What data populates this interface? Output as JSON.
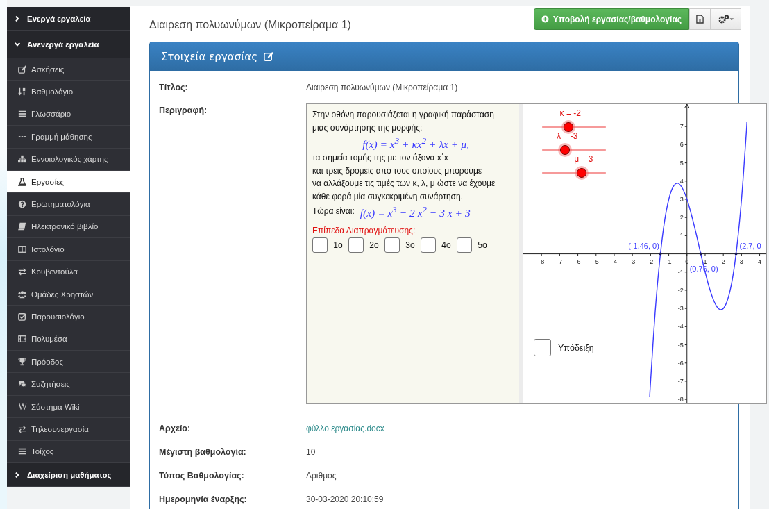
{
  "sidebar": {
    "sections": [
      {
        "label": "Ενεργά εργαλεία",
        "expanded": false
      },
      {
        "label": "Ανενεργά εργαλεία",
        "expanded": true,
        "items": [
          {
            "label": "Ασκήσεις",
            "selected": false
          },
          {
            "label": "Βαθμολόγιο",
            "selected": false
          },
          {
            "label": "Γλωσσάριο",
            "selected": false
          },
          {
            "label": "Γραμμή μάθησης",
            "selected": false
          },
          {
            "label": "Εννοιολογικός χάρτης",
            "selected": false
          },
          {
            "label": "Εργασίες",
            "selected": true
          },
          {
            "label": "Ερωτηματολόγια",
            "selected": false
          },
          {
            "label": "Ηλεκτρονικό βιβλίο",
            "selected": false
          },
          {
            "label": "Ιστολόγιο",
            "selected": false
          },
          {
            "label": "Κουβεντούλα",
            "selected": false
          },
          {
            "label": "Ομάδες Χρηστών",
            "selected": false
          },
          {
            "label": "Παρουσιολόγιο",
            "selected": false
          },
          {
            "label": "Πολυμέσα",
            "selected": false
          },
          {
            "label": "Πρόοδος",
            "selected": false
          },
          {
            "label": "Συζητήσεις",
            "selected": false
          },
          {
            "label": "Σύστημα Wiki",
            "selected": false,
            "icon": "W"
          },
          {
            "label": "Τηλεσυνεργασία",
            "selected": false
          },
          {
            "label": "Τοίχος",
            "selected": false
          }
        ]
      },
      {
        "label": "Διαχείριση μαθήματος",
        "expanded": false
      }
    ]
  },
  "header": {
    "title": "Διαιρεση πολυωνύμων (Μικροπείραμα 1)",
    "submit_button": "Υποβολή εργασίας/βαθμολογίας"
  },
  "panel": {
    "title": "Στοιχεία εργασίας",
    "rows": [
      {
        "kind": "text",
        "label": "Τίτλος:",
        "value": "Διαιρεση πολυωνύμων (Μικροπείραμα 1)"
      },
      {
        "kind": "applet",
        "label": "Περιγραφή:",
        "applet": {
          "intro": "Στην οθόνη παρουσιάζεται η γραφική παράσταση\nμιας συνάρτησης της μορφής:",
          "formula": "f(x) = x$^{3}$ + κx$^{2}$ + λx + μ,",
          "body": "τα σημεία τομής της με τον άξονα x΄x\nκαι τρεις δρομείς από τους οποίους μπορούμε\nνα αλλάξουμε τις τιμές των κ, λ, μ ώστε να έχουμε\nκάθε φορά μία συγκεκριμένη συνάρτηση.",
          "now_label": "Τώρα είναι:",
          "now_formula": "f(x) = x$^{3}$ − 2 x$^{2}$ − 3 x + 3",
          "levels_title": "Επίπεδα Διαπραγμάτευσης:",
          "levels": [
            {
              "label": "1ο",
              "checked": false
            },
            {
              "label": "2ο",
              "checked": false
            },
            {
              "label": "3ο",
              "checked": false
            },
            {
              "label": "4ο",
              "checked": false
            },
            {
              "label": "5ο",
              "checked": false
            }
          ],
          "graph": {
            "sliders": [
              {
                "label": "κ = -2",
                "level": 0.41
              },
              {
                "label": "λ = -3",
                "level": 0.36
              },
              {
                "label": "μ = 3",
                "level": 0.62
              }
            ],
            "hint": {
              "label": "Υπόδειξη",
              "checked": false
            },
            "chart_data": {
              "type": "line",
              "x": [
                -2.05,
                -2,
                -1.75,
                -1.5,
                -1.25,
                -1,
                -0.75,
                -0.5,
                -0.25,
                0,
                0.25,
                0.5,
                0.75,
                1,
                1.25,
                1.5,
                1.75,
                2,
                2.25,
                2.5,
                2.75,
                3,
                3.25,
                3.3
              ],
              "series": [
                {
                  "color": "#3a3aff",
                  "values": [
                    -7.87,
                    -7,
                    -3.23,
                    -0.38,
                    1.67,
                    3,
                    3.7,
                    3.88,
                    3.61,
                    3,
                    2.14,
                    1.13,
                    0.05,
                    -1,
                    -1.92,
                    -2.63,
                    -3.02,
                    -3,
                    -2.48,
                    -1.38,
                    0.42,
                    3,
                    6.45,
                    7.26
                  ]
                }
              ],
              "xlim": [
                -9,
                4.36
              ],
              "ylim": [
                -8.3,
                8.23
              ],
              "xticks": [
                -8,
                -7,
                -6,
                -5,
                -4,
                -3,
                -2,
                -1,
                0,
                1,
                2,
                3,
                4
              ],
              "yticks": [
                -8,
                -7,
                -6,
                -5,
                -4,
                -3,
                -2,
                -1,
                1,
                2,
                3,
                4,
                5,
                6,
                7
              ],
              "annotations": [
                {
                  "x": -1.46,
                  "y": 0,
                  "text": "(-1.46, 0)"
                },
                {
                  "x": 0.76,
                  "y": 0,
                  "text": "(0.76, 0)"
                },
                {
                  "x": 2.7,
                  "y": 0,
                  "text": "(2.7, 0"
                }
              ]
            }
          }
        }
      },
      {
        "kind": "link",
        "label": "Αρχείο:",
        "value": "φύλλο εργασίας.docx"
      },
      {
        "kind": "text",
        "label": "Μέγιστη βαθμολογία:",
        "value": "10"
      },
      {
        "kind": "text",
        "label": "Τύπος Βαθμολογίας:",
        "value": "Αριθμός"
      },
      {
        "kind": "text",
        "label": "Ημερομηνία έναρξης:",
        "value": "30-03-2020 20:10:59"
      }
    ]
  }
}
